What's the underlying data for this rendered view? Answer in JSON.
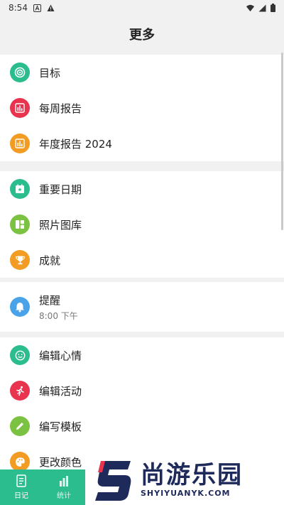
{
  "status_bar": {
    "time": "8:54"
  },
  "header": {
    "title": "更多"
  },
  "sections": [
    {
      "items": [
        {
          "label": "目标",
          "icon": "target-icon",
          "color": "#2bbd8e"
        },
        {
          "label": "每周报告",
          "icon": "bar-chart-icon",
          "color": "#e8344e"
        },
        {
          "label": "年度报告 2024",
          "icon": "bar-chart-icon",
          "color": "#f39c24"
        }
      ]
    },
    {
      "items": [
        {
          "label": "重要日期",
          "icon": "calendar-star-icon",
          "color": "#2bbd8e"
        },
        {
          "label": "照片图库",
          "icon": "gallery-grid-icon",
          "color": "#7cc242"
        },
        {
          "label": "成就",
          "icon": "trophy-icon",
          "color": "#f39c24"
        }
      ]
    },
    {
      "items": [
        {
          "label": "提醒",
          "sub": "8:00 下午",
          "icon": "bell-icon",
          "color": "#4aa3e8"
        }
      ]
    },
    {
      "items": [
        {
          "label": "编辑心情",
          "icon": "smiley-icon",
          "color": "#2bbd8e"
        },
        {
          "label": "编辑活动",
          "icon": "runner-icon",
          "color": "#e8344e"
        },
        {
          "label": "编写模板",
          "icon": "pencil-icon",
          "color": "#7cc242"
        },
        {
          "label": "更改颜色",
          "icon": "palette-icon",
          "color": "#f39c24"
        }
      ]
    }
  ],
  "bottom_nav": [
    {
      "label": "日记",
      "icon": "diary-icon"
    },
    {
      "label": "统计",
      "icon": "stats-icon"
    }
  ],
  "watermark": {
    "title": "尚游乐园",
    "url": "SHYIYUANYK.COM",
    "color": "#1e2a5a"
  }
}
